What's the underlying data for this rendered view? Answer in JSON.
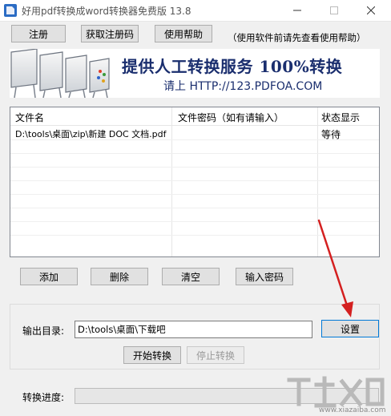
{
  "window": {
    "title": "好用pdf转换成word转换器免费版 13.8"
  },
  "toolbar": {
    "register_label": "注册",
    "get_code_label": "获取注册码",
    "help_label": "使用帮助",
    "note": "（使用软件前请先查看使用帮助）"
  },
  "banner": {
    "headline": "提供人工转换服务 100%转换",
    "subline": "请上  HTTP://123.PDFOA.COM"
  },
  "file_list": {
    "columns": [
      "文件名",
      "文件密码（如有请输入）",
      "状态显示"
    ],
    "rows": [
      {
        "name": "D:\\tools\\桌面\\zip\\新建 DOC 文档.pdf",
        "password": "",
        "status": "等待"
      }
    ]
  },
  "actions": {
    "add_label": "添加",
    "delete_label": "删除",
    "clear_label": "清空",
    "password_label": "输入密码"
  },
  "output": {
    "label": "输出目录:",
    "path": "D:\\tools\\桌面\\下载吧",
    "settings_label": "设置",
    "start_label": "开始转换",
    "stop_label": "停止转换"
  },
  "progress": {
    "label": "转换进度:",
    "value": 0
  },
  "watermark": {
    "url": "www.xiazaiba.com"
  },
  "colors": {
    "banner_text": "#1a2e6e",
    "annotation_arrow": "#d42020",
    "focus_border": "#0078d7"
  }
}
